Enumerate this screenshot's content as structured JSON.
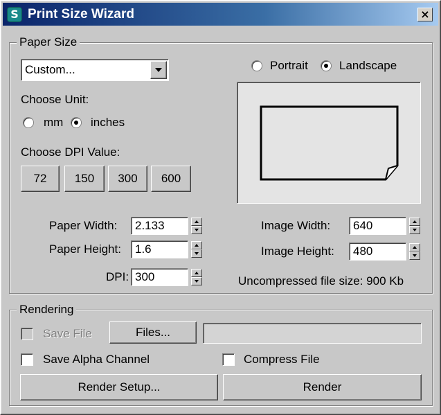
{
  "window": {
    "title": "Print Size Wizard",
    "close_glyph": "×",
    "app_icon_glyph": "S",
    "title_bar_color": "#0a246a"
  },
  "paper_size": {
    "group_label": "Paper Size",
    "size_select_value": "Custom...",
    "orientation": {
      "portrait_label": "Portrait",
      "landscape_label": "Landscape",
      "selected": "landscape"
    },
    "unit": {
      "label": "Choose Unit:",
      "mm_label": "mm",
      "inches_label": "inches",
      "selected": "inches"
    },
    "dpi_choice": {
      "label": "Choose DPI Value:",
      "buttons": [
        "72",
        "150",
        "300",
        "600"
      ]
    },
    "paper_width": {
      "label": "Paper Width:",
      "value": "2.133"
    },
    "paper_height": {
      "label": "Paper Height:",
      "value": "1.6"
    },
    "dpi": {
      "label": "DPI:",
      "value": "300"
    },
    "image_width": {
      "label": "Image Width:",
      "value": "640"
    },
    "image_height": {
      "label": "Image Height:",
      "value": "480"
    },
    "file_size_text": "Uncompressed file size: 900 Kb"
  },
  "rendering": {
    "group_label": "Rendering",
    "save_file": {
      "label": "Save File",
      "checked": false,
      "enabled": false
    },
    "files_button": "Files...",
    "file_path_value": "",
    "save_alpha": {
      "label": "Save Alpha Channel",
      "checked": false
    },
    "compress_file": {
      "label": "Compress File",
      "checked": false
    },
    "render_setup_button": "Render Setup...",
    "render_button": "Render"
  }
}
